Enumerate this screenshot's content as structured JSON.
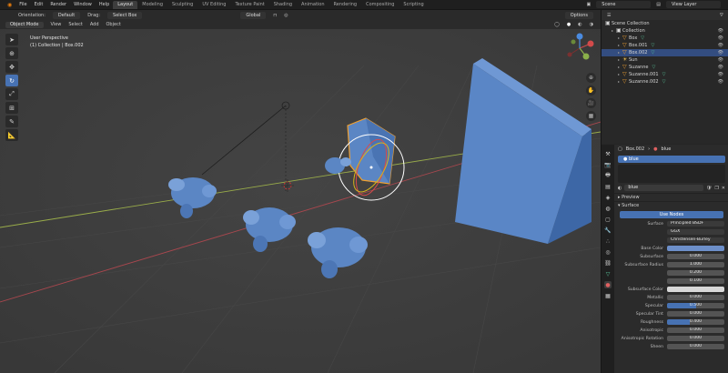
{
  "topbar": {
    "menu": [
      "File",
      "Edit",
      "Render",
      "Window",
      "Help"
    ],
    "tabs": [
      "Layout",
      "Modeling",
      "Sculpting",
      "UV Editing",
      "Texture Paint",
      "Shading",
      "Animation",
      "Rendering",
      "Compositing",
      "Scripting"
    ],
    "active_tab": "Layout",
    "scene": "Scene",
    "view_layer": "View Layer"
  },
  "toolheader": {
    "orientation_label": "Orientation:",
    "orientation_value": "Default",
    "drag_label": "Drag:",
    "drag_value": "Select Box",
    "transform_orientation": "Global",
    "options": "Options"
  },
  "vpheader": {
    "mode": "Object Mode",
    "menus": [
      "View",
      "Select",
      "Add",
      "Object"
    ]
  },
  "viewport": {
    "info_line1": "User Perspective",
    "info_line2": "(1) Collection | Box.002"
  },
  "outliner": {
    "title": "Scene Collection",
    "items": [
      {
        "name": "Collection",
        "level": 1,
        "icon": "collection",
        "selected": false,
        "mod": false
      },
      {
        "name": "Box",
        "level": 2,
        "icon": "mesh",
        "selected": false,
        "mod": true
      },
      {
        "name": "Box.001",
        "level": 2,
        "icon": "mesh",
        "selected": false,
        "mod": true
      },
      {
        "name": "Box.002",
        "level": 2,
        "icon": "mesh",
        "selected": true,
        "mod": true
      },
      {
        "name": "Sun",
        "level": 2,
        "icon": "light",
        "selected": false,
        "mod": false
      },
      {
        "name": "Suzanne",
        "level": 2,
        "icon": "mesh",
        "selected": false,
        "mod": true
      },
      {
        "name": "Suzanne.001",
        "level": 2,
        "icon": "mesh",
        "selected": false,
        "mod": true
      },
      {
        "name": "Suzanne.002",
        "level": 2,
        "icon": "mesh",
        "selected": false,
        "mod": true
      }
    ]
  },
  "properties": {
    "object": "Box.002",
    "material_header": "blue",
    "slot": "blue",
    "material_field": "blue",
    "sections": {
      "preview": "Preview",
      "surface": "Surface"
    },
    "use_nodes": "Use Nodes",
    "rows": [
      {
        "label": "Surface",
        "value": "Principled BSDF",
        "type": "text"
      },
      {
        "label": "",
        "value": "GGX",
        "type": "text"
      },
      {
        "label": "",
        "value": "Christensen-Burley",
        "type": "text"
      },
      {
        "label": "Base Color",
        "value": "",
        "type": "swatch"
      },
      {
        "label": "Subsurface",
        "value": "0.000",
        "type": "num",
        "fill": 0
      },
      {
        "label": "Subsurface Radius",
        "value": "1.000",
        "type": "num",
        "fill": 0
      },
      {
        "label": "",
        "value": "0.200",
        "type": "num",
        "fill": 0
      },
      {
        "label": "",
        "value": "0.100",
        "type": "num",
        "fill": 0
      },
      {
        "label": "Subsurface Color",
        "value": "",
        "type": "swatch2"
      },
      {
        "label": "Metallic",
        "value": "0.000",
        "type": "num",
        "fill": 0
      },
      {
        "label": "Specular",
        "value": "0.500",
        "type": "num",
        "fill": 0.5
      },
      {
        "label": "Specular Tint",
        "value": "0.000",
        "type": "num",
        "fill": 0
      },
      {
        "label": "Roughness",
        "value": "0.400",
        "type": "num",
        "fill": 0.4
      },
      {
        "label": "Anisotropic",
        "value": "0.000",
        "type": "num",
        "fill": 0
      },
      {
        "label": "Anisotropic Rotation",
        "value": "0.000",
        "type": "num",
        "fill": 0
      },
      {
        "label": "Sheen",
        "value": "0.000",
        "type": "num",
        "fill": 0
      }
    ]
  },
  "colors": {
    "accent": "#4772b3",
    "selection_orange": "#f0a030",
    "object_blue": "#5b86c4"
  }
}
